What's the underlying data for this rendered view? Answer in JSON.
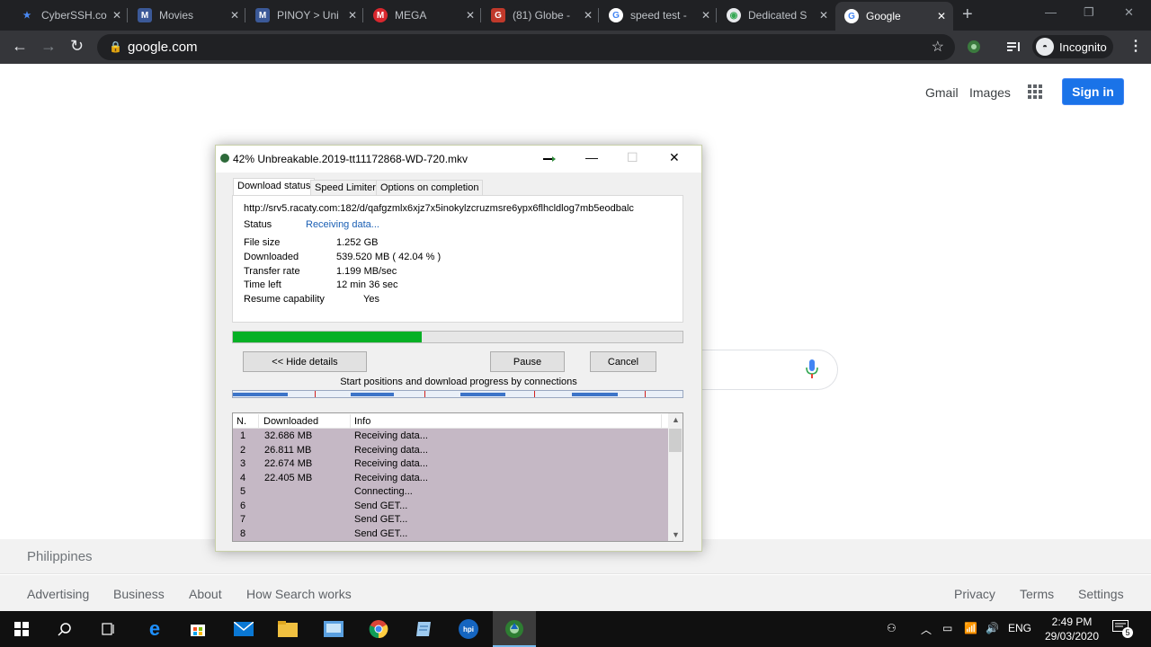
{
  "browser": {
    "tabs": [
      {
        "label": "CyberSSH.co",
        "favicon": "star-icon",
        "color": "#4a8af4"
      },
      {
        "label": "Movies",
        "favicon": "pinoy-icon",
        "color": "#3b5998"
      },
      {
        "label": "PINOY > Uni",
        "favicon": "pinoy-icon",
        "color": "#3b5998"
      },
      {
        "label": "MEGA",
        "favicon": "mega-icon",
        "color": "#d9272e"
      },
      {
        "label": "(81) Globe -",
        "favicon": "shield-icon",
        "color": "#c0392b"
      },
      {
        "label": "speed test -",
        "favicon": "google-icon",
        "color": "#4285f4"
      },
      {
        "label": "Dedicated S",
        "favicon": "globe-icon",
        "color": "#34a853"
      },
      {
        "label": "Google",
        "favicon": "google-icon",
        "color": "#4285f4"
      }
    ],
    "active_tab_index": 7,
    "url": "google.com",
    "incognito_label": "Incognito"
  },
  "google": {
    "gmail": "Gmail",
    "images": "Images",
    "signin": "Sign in",
    "country": "Philippines",
    "footer_left": [
      "Advertising",
      "Business",
      "About",
      "How Search works"
    ],
    "footer_right": [
      "Privacy",
      "Terms",
      "Settings"
    ]
  },
  "dialog": {
    "title": "42% Unbreakable.2019-tt11172868-WD-720.mkv",
    "tabs": [
      "Download status",
      "Speed Limiter",
      "Options on completion"
    ],
    "url": "http://srv5.racaty.com:182/d/qafgzmlx6xjz7x5inokylzcruzmsre6ypx6flhcldlog7mb5eodbalc",
    "status_label": "Status",
    "status_value": "Receiving data...",
    "fields": [
      {
        "label": "File size",
        "value": "1.252  GB"
      },
      {
        "label": "Downloaded",
        "value": "539.520  MB  ( 42.04 % )"
      },
      {
        "label": "Transfer rate",
        "value": "1.199  MB/sec"
      },
      {
        "label": "Time left",
        "value": "12 min 36 sec"
      },
      {
        "label": "Resume capability",
        "value": "Yes"
      }
    ],
    "progress_percent": 42.04,
    "buttons": {
      "hide_details": "<< Hide details",
      "pause": "Pause",
      "cancel": "Cancel"
    },
    "connections_label": "Start positions and download progress by connections",
    "columns": [
      "N.",
      "Downloaded",
      "Info"
    ],
    "rows": [
      {
        "n": "1",
        "downloaded": "32.686  MB",
        "info": "Receiving data..."
      },
      {
        "n": "2",
        "downloaded": "26.811  MB",
        "info": "Receiving data..."
      },
      {
        "n": "3",
        "downloaded": "22.674  MB",
        "info": "Receiving data..."
      },
      {
        "n": "4",
        "downloaded": "22.405  MB",
        "info": "Receiving data..."
      },
      {
        "n": "5",
        "downloaded": "",
        "info": "Connecting..."
      },
      {
        "n": "6",
        "downloaded": "",
        "info": "Send GET..."
      },
      {
        "n": "7",
        "downloaded": "",
        "info": "Send GET..."
      },
      {
        "n": "8",
        "downloaded": "",
        "info": "Send GET..."
      }
    ]
  },
  "taskbar": {
    "language": "ENG",
    "time": "2:49 PM",
    "date": "29/03/2020",
    "notification_count": "5"
  }
}
